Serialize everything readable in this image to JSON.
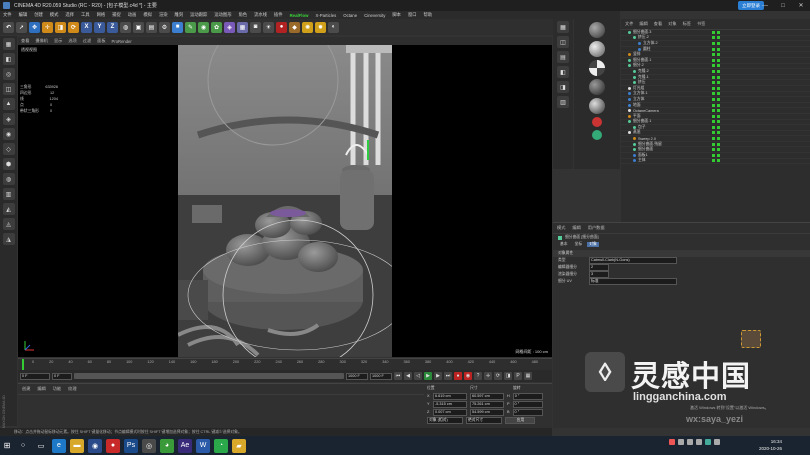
{
  "window": {
    "title": "CINEMA 4D R20.059 Studio (RC - R20) - [包子模型.c4d *] - 主要",
    "login_label": "立即登录",
    "controls": [
      "—",
      "□",
      "✕"
    ]
  },
  "menubar": {
    "items": [
      "文件",
      "编辑",
      "创建",
      "模式",
      "选择",
      "工具",
      "网格",
      "捕捉",
      "动画",
      "模拟",
      "渲染",
      "雕刻",
      "运动跟踪",
      "运动图形",
      "角色",
      "流水线",
      "插件",
      "RealFlow",
      "X-Particles",
      "Octane",
      "Cineversity",
      "脚本",
      "窗口",
      "帮助"
    ],
    "highlight": "RealFlow"
  },
  "toolbar": {
    "tools": [
      {
        "icon": "undo-icon",
        "glyph": "↶",
        "color": "#4b4b4b"
      },
      {
        "icon": "select-arrow-icon",
        "glyph": "➚",
        "color": "#4b4b4b"
      },
      {
        "icon": "live-select-icon",
        "glyph": "✥",
        "color": "#2f6fbf"
      },
      {
        "icon": "move-icon",
        "glyph": "✛",
        "color": "#d08a1a"
      },
      {
        "icon": "scale-icon",
        "glyph": "◨",
        "color": "#d08a1a"
      },
      {
        "icon": "rotate-icon",
        "glyph": "⟳",
        "color": "#d08a1a"
      },
      {
        "icon": "x-axis-icon",
        "glyph": "X",
        "color": "#3a5a9a"
      },
      {
        "icon": "y-axis-icon",
        "glyph": "Y",
        "color": "#3a5a9a"
      },
      {
        "icon": "z-axis-icon",
        "glyph": "Z",
        "color": "#3a5a9a"
      },
      {
        "icon": "world-icon",
        "glyph": "◍",
        "color": "#4b4b4b"
      },
      {
        "icon": "render-view-icon",
        "glyph": "▣",
        "color": "#4b4b4b"
      },
      {
        "icon": "render-picture-icon",
        "glyph": "▤",
        "color": "#4b4b4b"
      },
      {
        "icon": "render-settings-icon",
        "glyph": "⚙",
        "color": "#4b4b4b"
      },
      {
        "icon": "cube-icon",
        "glyph": "■",
        "color": "#3c7fd0"
      },
      {
        "icon": "pen-icon",
        "glyph": "✎",
        "color": "#4a9a4a"
      },
      {
        "icon": "subdivision-icon",
        "glyph": "◉",
        "color": "#4a9a4a"
      },
      {
        "icon": "array-icon",
        "glyph": "✿",
        "color": "#4a9a4a"
      },
      {
        "icon": "deformer-icon",
        "glyph": "◈",
        "color": "#7a5ab8"
      },
      {
        "icon": "scene-icon",
        "glyph": "▦",
        "color": "#6a6aa8"
      },
      {
        "icon": "camera-icon",
        "glyph": "◙",
        "color": "#4b4b4b"
      },
      {
        "icon": "light-icon",
        "glyph": "☀",
        "color": "#4b4b4b"
      },
      {
        "icon": "octane-live-icon",
        "glyph": "●",
        "color": "#b22222"
      },
      {
        "icon": "octane-tex-icon",
        "glyph": "◆",
        "color": "#9a6a2a"
      },
      {
        "icon": "octane-sun-icon",
        "glyph": "✺",
        "color": "#d0a01a"
      },
      {
        "icon": "octane-light-icon",
        "glyph": "✹",
        "color": "#d0a01a"
      },
      {
        "icon": "octane-camera-icon",
        "glyph": "◐",
        "color": "#4b4b4b"
      }
    ]
  },
  "left_tools": [
    "▦",
    "◧",
    "◎",
    "◫",
    "▲",
    "◈",
    "◉",
    "◇",
    "⬢",
    "◍",
    "▥",
    "◭",
    "◬",
    "◮"
  ],
  "viewport": {
    "menu": [
      "查看",
      "摄像机",
      "显示",
      "选项",
      "过滤",
      "面板",
      "ProRender"
    ],
    "label": "透视视图",
    "stats": [
      {
        "k": "三角形",
        "v": "633926"
      },
      {
        "k": "四边形",
        "v": "12"
      },
      {
        "k": "线",
        "v": "1204"
      },
      {
        "k": "点",
        "v": "0"
      },
      {
        "k": "带状三角形",
        "v": "0"
      }
    ],
    "grid_distance": "网格间距 : 100 cm"
  },
  "timeline": {
    "ticks": [
      "0",
      "10",
      "20",
      "30",
      "40",
      "50",
      "60",
      "70",
      "80",
      "90",
      "100",
      "110",
      "120",
      "130",
      "140",
      "150",
      "160",
      "170",
      "180",
      "190",
      "200",
      "210",
      "220",
      "230",
      "240",
      "250",
      "260",
      "270",
      "280",
      "290",
      "300",
      "310",
      "320",
      "330",
      "340",
      "350",
      "360",
      "370",
      "380",
      "390",
      "400",
      "410",
      "420",
      "430",
      "440",
      "450",
      "460",
      "470",
      "480",
      "490"
    ],
    "current_frame": "0 F",
    "start_frame": "0 F",
    "end_frame": "1000 F",
    "max_frame": "1000 F"
  },
  "material_manager": {
    "menu": [
      "创建",
      "编辑",
      "功能",
      "纹理"
    ]
  },
  "coordinates": {
    "headers": [
      "位置",
      "尺寸",
      "旋转"
    ],
    "rows": [
      {
        "axis": "X",
        "pos": "6.619 cm",
        "size": "60.597 cm",
        "rlabel": "H",
        "rot": "0 °"
      },
      {
        "axis": "Y",
        "pos": "-5.315 cm",
        "size": "75.261 cm",
        "rlabel": "P",
        "rot": "0 °"
      },
      {
        "axis": "Z",
        "pos": "0.007 cm",
        "size": "54.599 cm",
        "rlabel": "B",
        "rot": "0 °"
      }
    ],
    "mode_select": "对象 (相对)",
    "size_select": "绝对尺寸",
    "apply_label": "应用"
  },
  "status_text": "移动：点击并拖动鼠标移动元素。按住 SHIFT 键量化移动；节点编辑模式时按住 SHIFT 键增加选择对象；按住 CTRL 键减少选择对象。",
  "maxon_label": "MAXON CINEMA 4D",
  "object_manager": {
    "menu": [
      "文件",
      "编辑",
      "查看",
      "对象",
      "标签",
      "书签"
    ],
    "rows": [
      {
        "name": "细分曲面.3",
        "indent": 1,
        "color": "#5c9"
      },
      {
        "name": "挤压.2",
        "indent": 2,
        "color": "#5c9"
      },
      {
        "name": "立方体.2",
        "indent": 3,
        "color": "#3c7fd0"
      },
      {
        "name": "圆柱",
        "indent": 3,
        "color": "#3c7fd0"
      },
      {
        "name": "竖排",
        "indent": 1,
        "color": "#d08a1a"
      },
      {
        "name": "细分曲面.1",
        "indent": 1,
        "color": "#5c9"
      },
      {
        "name": "细分.2",
        "indent": 1,
        "color": "#5c9"
      },
      {
        "name": "克隆.2",
        "indent": 2,
        "color": "#5c9"
      },
      {
        "name": "克隆.1",
        "indent": 2,
        "color": "#5c9"
      },
      {
        "name": "挤压",
        "indent": 2,
        "color": "#5c9"
      },
      {
        "name": "灯光组",
        "indent": 1,
        "color": "#ddd"
      },
      {
        "name": "立方体.1",
        "indent": 1,
        "color": "#3c7fd0"
      },
      {
        "name": "立方体",
        "indent": 1,
        "color": "#3c7fd0"
      },
      {
        "name": "地面",
        "indent": 1,
        "color": "#3c7fd0"
      },
      {
        "name": "OctaneCamera",
        "indent": 1,
        "color": "#ddd"
      },
      {
        "name": "平面",
        "indent": 1,
        "color": "#d08a1a"
      },
      {
        "name": "细分曲面.1",
        "indent": 1,
        "color": "#5c9"
      },
      {
        "name": "包子",
        "indent": 2,
        "color": "#5c9"
      },
      {
        "name": "蒸笼",
        "indent": 1,
        "color": "#ddd"
      },
      {
        "name": "Sweep 2.0",
        "indent": 2,
        "color": "#d08a1a"
      },
      {
        "name": "细分曲面.残留",
        "indent": 2,
        "color": "#5c9"
      },
      {
        "name": "细分曲面",
        "indent": 2,
        "color": "#5c9"
      },
      {
        "name": "面板1",
        "indent": 2,
        "color": "#3c7fd0"
      },
      {
        "name": "主体",
        "indent": 2,
        "color": "#3c7fd0"
      }
    ]
  },
  "attribute_manager": {
    "menu": [
      "模式",
      "编辑",
      "用户数据"
    ],
    "object_title": "细分曲面 [细分曲面]",
    "tabs": [
      "基本",
      "坐标",
      "对象"
    ],
    "active_tab": "对象",
    "section": "对象属性",
    "fields": [
      {
        "label": "类型",
        "value": "Catmull-Clark(N-Gons)",
        "kind": "select"
      },
      {
        "label": "编辑器细分",
        "value": "2",
        "kind": "num"
      },
      {
        "label": "渲染器细分",
        "value": "3",
        "kind": "num"
      },
      {
        "label": "细分 UV",
        "value": "标准",
        "kind": "select"
      }
    ]
  },
  "watermark": {
    "logo_glyph": "◊",
    "title": "灵感中国",
    "url": "lingganchina.com",
    "user": "wx:saya_yezi",
    "win_hint": "激活 Windows 转到\"设置\"以激活 Windows。"
  },
  "taskbar": {
    "apps": [
      {
        "icon": "search-icon",
        "glyph": "○",
        "color": "#1a2430"
      },
      {
        "icon": "task-view-icon",
        "glyph": "▭",
        "color": "#1a2430"
      },
      {
        "icon": "edge-icon",
        "glyph": "e",
        "color": "#1e78c8"
      },
      {
        "icon": "explorer-icon",
        "glyph": "▬",
        "color": "#d8a82a"
      },
      {
        "icon": "c4d-icon",
        "glyph": "◉",
        "color": "#2a4a8a"
      },
      {
        "icon": "record-icon",
        "glyph": "●",
        "color": "#c82a2a"
      },
      {
        "icon": "photoshop-icon",
        "glyph": "Ps",
        "color": "#1a4a8a"
      },
      {
        "icon": "app-icon",
        "glyph": "◎",
        "color": "#4a4a4a"
      },
      {
        "icon": "chrome-icon",
        "glyph": "◕",
        "color": "#3a9a3a"
      },
      {
        "icon": "aftereffects-icon",
        "glyph": "Ae",
        "color": "#3a2a7a"
      },
      {
        "icon": "word-icon",
        "glyph": "W",
        "color": "#2a5aa8"
      },
      {
        "icon": "wechat-icon",
        "glyph": "◔",
        "color": "#2aa84a"
      },
      {
        "icon": "folder-icon",
        "glyph": "▰",
        "color": "#d8a82a"
      }
    ],
    "time": "16:34",
    "date": "2020-10-26"
  }
}
